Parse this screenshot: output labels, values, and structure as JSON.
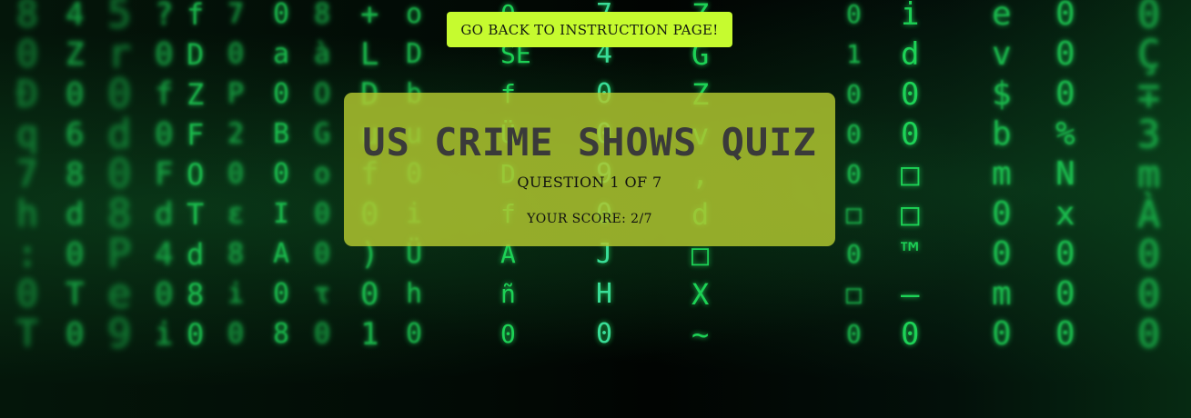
{
  "navigation": {
    "back_button_label": "GO BACK TO INSTRUCTION PAGE!"
  },
  "header": {
    "title": "US CRIME SHOWS QUIZ",
    "question_prefix": "QUESTION",
    "question_current": 1,
    "question_separator": "OF",
    "question_total": 7,
    "score_label": "YOUR SCORE:",
    "score_value": "2/7"
  },
  "background": {
    "theme": "matrix-code-rain",
    "colors": {
      "code": "#1fdc5a",
      "dark": "#030a05",
      "button": "#c6fb2f",
      "panel": "#b0c630"
    }
  }
}
